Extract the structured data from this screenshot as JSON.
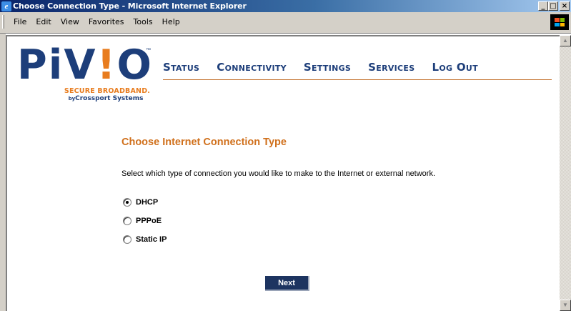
{
  "window": {
    "title": "Choose Connection Type - Microsoft Internet Explorer",
    "controls": {
      "minimize": "_",
      "maximize": "□",
      "close": "×"
    }
  },
  "menu": [
    "File",
    "Edit",
    "View",
    "Favorites",
    "Tools",
    "Help"
  ],
  "logo": {
    "brand_left": "PiV",
    "brand_bang": "!",
    "brand_right": "O",
    "tm": "™",
    "tagline": "SECURE BROADBAND.",
    "by": "by",
    "company": "Crossport Systems"
  },
  "nav": [
    {
      "label": "Status"
    },
    {
      "label": "Connectivity"
    },
    {
      "label": "Settings"
    },
    {
      "label": "Services"
    },
    {
      "label": "Log Out"
    }
  ],
  "main": {
    "heading": "Choose Internet Connection Type",
    "description": "Select which type of connection you would like to make to the Internet or external network.",
    "options": [
      {
        "label": "DHCP",
        "checked": true
      },
      {
        "label": "PPPoE",
        "checked": false
      },
      {
        "label": "Static IP",
        "checked": false
      }
    ],
    "next_label": "Next"
  },
  "colors": {
    "brand_navy": "#1d3e7a",
    "brand_orange": "#e87c1e",
    "heading_orange": "#d0701c",
    "button_navy": "#1d3460"
  }
}
